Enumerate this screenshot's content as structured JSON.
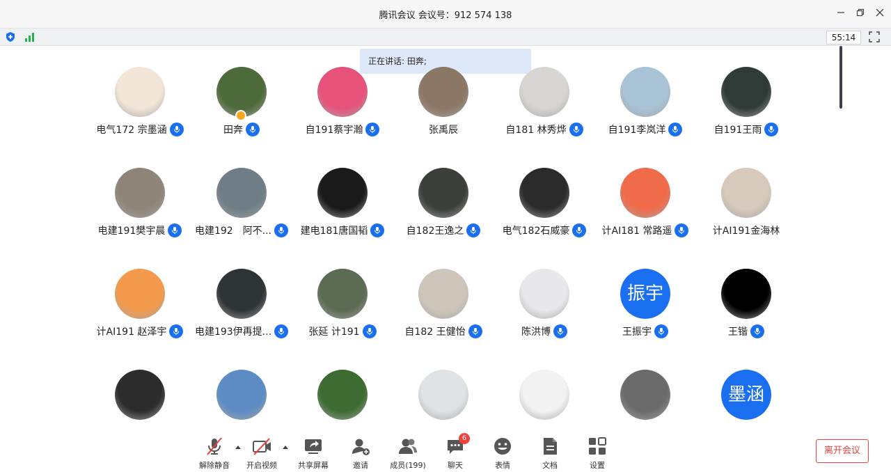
{
  "window": {
    "title": "腾讯会议  会议号：912 574 138"
  },
  "toolbar": {
    "timer": "55:14"
  },
  "speaking": {
    "text": "正在讲话: 田奔;"
  },
  "participants": [
    {
      "name": "电气172 宗墨涵",
      "mic": true,
      "avatar_color": "#f3e6d8"
    },
    {
      "name": "田奔",
      "mic": true,
      "host": true,
      "avatar_color": "#4d6a3a"
    },
    {
      "name": "自191蔡宇瀚",
      "mic": true,
      "avatar_color": "#e6527a"
    },
    {
      "name": "张禹辰",
      "mic": false,
      "avatar_color": "#8b7765"
    },
    {
      "name": "自181 林秀烨",
      "mic": true,
      "avatar_color": "#d8d5d2"
    },
    {
      "name": "自191李岚洋",
      "mic": true,
      "avatar_color": "#a9c3d6"
    },
    {
      "name": "自191王雨",
      "mic": true,
      "avatar_color": "#2f3b36"
    },
    {
      "name": "电建191樊宇晨",
      "mic": true,
      "avatar_color": "#8f8478"
    },
    {
      "name": "电建192　阿不...",
      "mic": true,
      "avatar_color": "#6f7d86"
    },
    {
      "name": "建电181唐国韬",
      "mic": true,
      "avatar_color": "#1a1a1a"
    },
    {
      "name": "自182王逸之",
      "mic": true,
      "avatar_color": "#3a3f3a"
    },
    {
      "name": "电气182石威豪",
      "mic": true,
      "avatar_color": "#2b2b2b"
    },
    {
      "name": "计AI181 常路遥",
      "mic": true,
      "avatar_color": "#f06b4a"
    },
    {
      "name": "计AI191金海林",
      "mic": false,
      "avatar_color": "#d7c9bb"
    },
    {
      "name": "计AI191 赵泽宇",
      "mic": true,
      "avatar_color": "#f39a4c"
    },
    {
      "name": "电建193伊再提...",
      "mic": true,
      "avatar_color": "#2e3336"
    },
    {
      "name": "张延 计191",
      "mic": true,
      "avatar_color": "#5b6a52"
    },
    {
      "name": "自182 王健怡",
      "mic": true,
      "avatar_color": "#cfc6bb"
    },
    {
      "name": "陈洪博",
      "mic": true,
      "avatar_color": "#e8e8ec"
    },
    {
      "name": "王振宇",
      "mic": true,
      "avatar_color": "#1a6ff0",
      "avatar_text": "振宇"
    },
    {
      "name": "王锴",
      "mic": true,
      "avatar_color": "#000000"
    },
    {
      "name": "",
      "mic": false,
      "avatar_color": "#2c2c2c"
    },
    {
      "name": "",
      "mic": false,
      "avatar_color": "#5d8bc4"
    },
    {
      "name": "",
      "mic": false,
      "avatar_color": "#3d6b31"
    },
    {
      "name": "",
      "mic": false,
      "avatar_color": "#dfe3e6"
    },
    {
      "name": "",
      "mic": false,
      "avatar_color": "#f2f2f2"
    },
    {
      "name": "",
      "mic": false,
      "avatar_color": "#6b6b6b"
    },
    {
      "name": "",
      "mic": false,
      "avatar_color": "#1a6ff0",
      "avatar_text": "墨涵"
    }
  ],
  "bottombar": {
    "unmute": "解除静音",
    "video": "开启视频",
    "share": "共享屏幕",
    "invite": "邀请",
    "members": "成员(199)",
    "chat": "聊天",
    "chat_badge": "6",
    "emoji": "表情",
    "docs": "文档",
    "settings": "设置",
    "leave": "离开会议"
  },
  "colors": {
    "accent": "#1a6ff0",
    "leave": "#e5443d",
    "badge": "#f0413b"
  }
}
